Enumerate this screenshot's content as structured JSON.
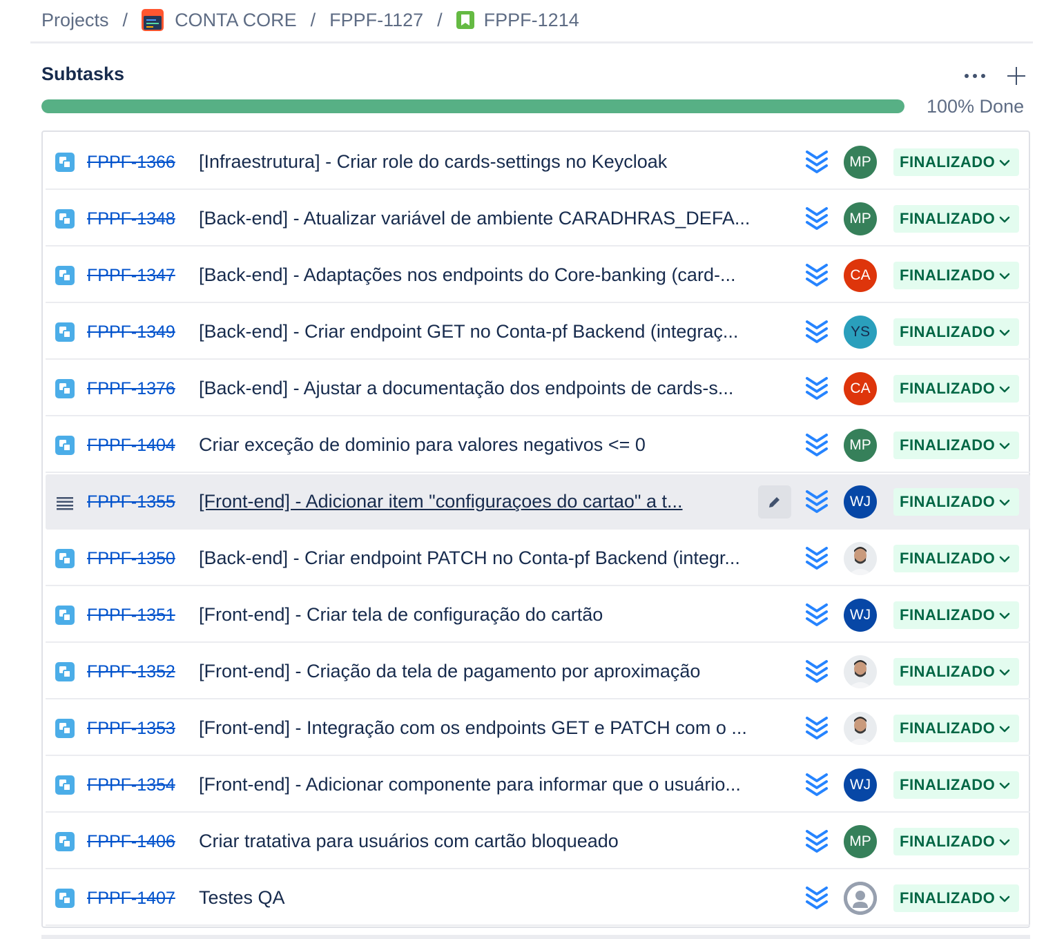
{
  "breadcrumb": {
    "items": [
      "Projects",
      "CONTA CORE",
      "FPPF-1127",
      "FPPF-1214"
    ],
    "separator": "/"
  },
  "subtasks": {
    "title": "Subtasks",
    "progress_percent": 100,
    "progress_label": "100% Done",
    "colors": {
      "progress": "#57b085",
      "key_link": "#0052cc",
      "status_bg": "#e3fcef",
      "status_text": "#006644",
      "priority": "#2684ff"
    },
    "rows": [
      {
        "key": "FPPF-1366",
        "summary": "[Infraestrutura] - Criar role do cards-settings no Keycloak",
        "type_icon": "subtask-icon",
        "priority_icon": "lowest-priority-icon",
        "assignee": "MP",
        "avatar_color": "#36805a",
        "status": "FINALIZADO"
      },
      {
        "key": "FPPF-1348",
        "summary": "[Back-end] - Atualizar variável de ambiente CARADHRAS_DEFA...",
        "type_icon": "subtask-icon",
        "priority_icon": "lowest-priority-icon",
        "assignee": "MP",
        "avatar_color": "#36805a",
        "status": "FINALIZADO"
      },
      {
        "key": "FPPF-1347",
        "summary": "[Back-end] - Adaptações nos endpoints do Core-banking (card-...",
        "type_icon": "subtask-icon",
        "priority_icon": "lowest-priority-icon",
        "assignee": "CA",
        "avatar_color": "#de350b",
        "status": "FINALIZADO"
      },
      {
        "key": "FPPF-1349",
        "summary": "[Back-end] - Criar endpoint GET no Conta-pf Backend (integraç...",
        "type_icon": "subtask-icon",
        "priority_icon": "lowest-priority-icon",
        "assignee": "YS",
        "avatar_color": "#2a9fbc",
        "avatar_text_color": "#172b4d",
        "status": "FINALIZADO"
      },
      {
        "key": "FPPF-1376",
        "summary": "[Back-end] - Ajustar a documentação dos endpoints de cards-s...",
        "type_icon": "subtask-icon",
        "priority_icon": "lowest-priority-icon",
        "assignee": "CA",
        "avatar_color": "#de350b",
        "status": "FINALIZADO"
      },
      {
        "key": "FPPF-1404",
        "summary": "Criar exceção de dominio para valores negativos <= 0",
        "type_icon": "subtask-icon",
        "priority_icon": "lowest-priority-icon",
        "assignee": "MP",
        "avatar_color": "#36805a",
        "status": "FINALIZADO"
      },
      {
        "key": "FPPF-1355",
        "summary": "[Front-end] - Adicionar item \"configuraçoes do cartao\" a t...",
        "type_icon": "drag-handle-icon",
        "priority_icon": "lowest-priority-icon",
        "assignee": "WJ",
        "avatar_color": "#0747a6",
        "status": "FINALIZADO",
        "hover": true
      },
      {
        "key": "FPPF-1350",
        "summary": "[Back-end] - Criar endpoint PATCH no Conta-pf Backend (integr...",
        "type_icon": "subtask-icon",
        "priority_icon": "lowest-priority-icon",
        "assignee": "",
        "avatar_color": "#ffffff",
        "avatar_photo": true,
        "status": "FINALIZADO"
      },
      {
        "key": "FPPF-1351",
        "summary": "[Front-end] - Criar tela de configuração do cartão",
        "type_icon": "subtask-icon",
        "priority_icon": "lowest-priority-icon",
        "assignee": "WJ",
        "avatar_color": "#0747a6",
        "status": "FINALIZADO"
      },
      {
        "key": "FPPF-1352",
        "summary": "[Front-end] - Criação da tela de pagamento por aproximação",
        "type_icon": "subtask-icon",
        "priority_icon": "lowest-priority-icon",
        "assignee": "",
        "avatar_color": "#ffffff",
        "avatar_photo": true,
        "status": "FINALIZADO"
      },
      {
        "key": "FPPF-1353",
        "summary": "[Front-end] - Integração com os endpoints GET e PATCH com o ...",
        "type_icon": "subtask-icon",
        "priority_icon": "lowest-priority-icon",
        "assignee": "",
        "avatar_color": "#ffffff",
        "avatar_photo": true,
        "status": "FINALIZADO"
      },
      {
        "key": "FPPF-1354",
        "summary": "[Front-end] - Adicionar componente para informar que o usuário...",
        "type_icon": "subtask-icon",
        "priority_icon": "lowest-priority-icon",
        "assignee": "WJ",
        "avatar_color": "#0747a6",
        "status": "FINALIZADO"
      },
      {
        "key": "FPPF-1406",
        "summary": "Criar tratativa para usuários com cartão bloqueado",
        "type_icon": "subtask-icon",
        "priority_icon": "lowest-priority-icon",
        "assignee": "MP",
        "avatar_color": "#36805a",
        "status": "FINALIZADO"
      },
      {
        "key": "FPPF-1407",
        "summary": "Testes QA",
        "type_icon": "subtask-icon",
        "priority_icon": "lowest-priority-icon",
        "assignee": "",
        "avatar_color": "#97a0af",
        "avatar_default": true,
        "status": "FINALIZADO"
      }
    ]
  }
}
